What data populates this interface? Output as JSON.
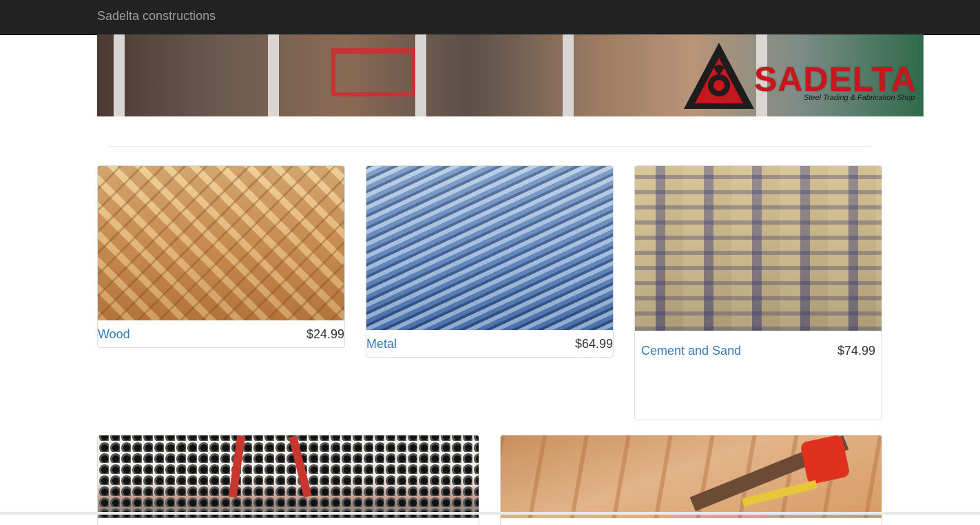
{
  "navbar": {
    "brand": "Sadelta constructions"
  },
  "banner": {
    "logo_word": "SADELTA",
    "logo_tagline": "Steel Trading & Fabrication Shop",
    "logo_symbol": "delta-triangle-icon",
    "brand_color": "#c8161d"
  },
  "products": [
    {
      "title": "Wood",
      "price": "$24.99",
      "image": "stacked-timber-image"
    },
    {
      "title": "Metal",
      "price": "$64.99",
      "image": "steel-rebar-image"
    },
    {
      "title": "Cement and Sand",
      "price": "$74.99",
      "image": "cement-bags-image"
    }
  ],
  "featured": [
    {
      "image": "steel-pipes-crane-image"
    },
    {
      "image": "lumber-and-tape-measure-image"
    }
  ],
  "colors": {
    "navbar_bg": "#222222",
    "link": "#337ab7",
    "text": "#333333"
  }
}
